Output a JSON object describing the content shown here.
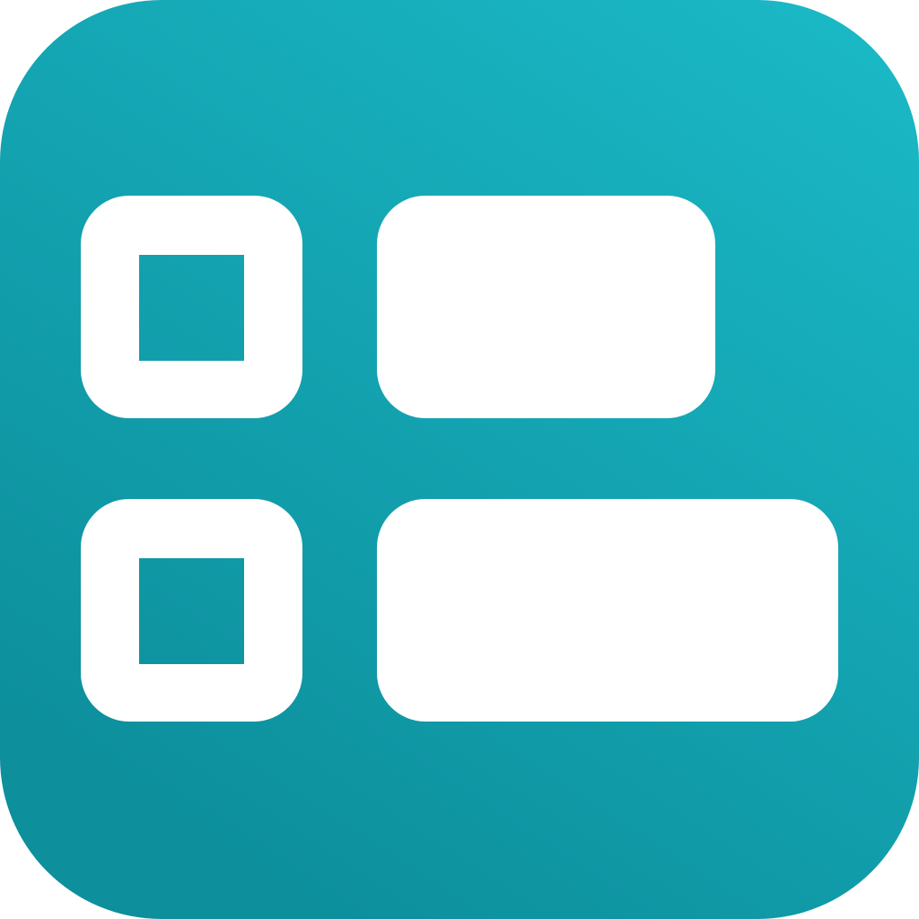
{
  "icon": {
    "name": "checklist-layout-icon",
    "colors": {
      "gradient_top": "#1bbac8",
      "gradient_bottom": "#0d8f9c",
      "foreground": "#ffffff"
    },
    "rows": [
      {
        "checkbox": "checkbox-outline-icon",
        "bar": "content-bar-short"
      },
      {
        "checkbox": "checkbox-outline-icon",
        "bar": "content-bar-long"
      }
    ]
  }
}
